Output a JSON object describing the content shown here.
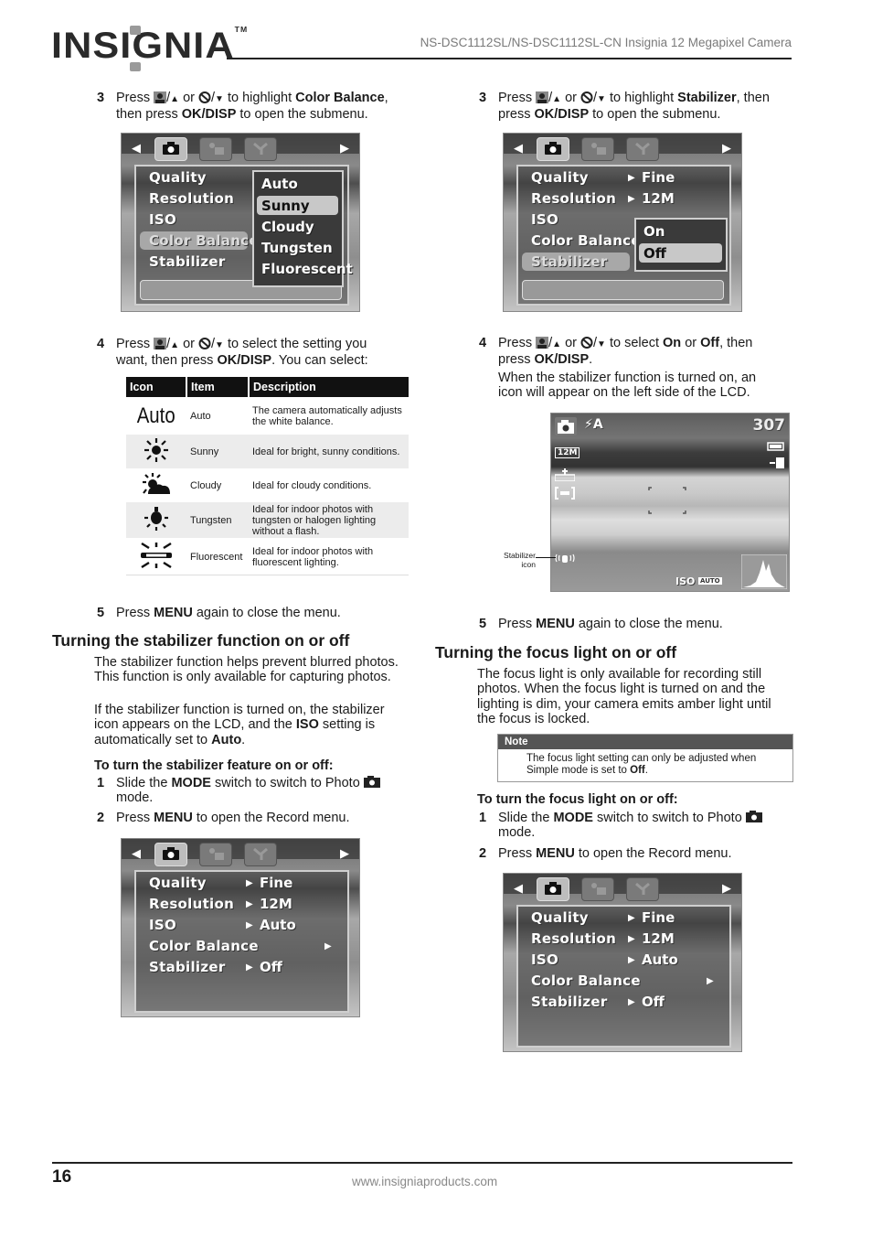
{
  "header": {
    "logo": "INSIGNIA",
    "logo_tm": "TM",
    "title": "NS-DSC1112SL/NS-DSC1112SL-CN Insignia 12 Megapixel Camera"
  },
  "left": {
    "step3": {
      "num": "3",
      "pre": "Press",
      "mid1": "/",
      "up": "▲",
      "or": "or",
      "mid2": "/",
      "down": "▼",
      "post": "to highlight",
      "bold1": "Color Balance",
      "comma": ",",
      "line2_pre": "then press",
      "bold2": "OK/DISP",
      "line2_post": "to open the submenu."
    },
    "screen1": {
      "menu_items": [
        "Quality",
        "Resolution",
        "ISO",
        "Color Balance",
        "Stabilizer"
      ],
      "highlighted": "Color Balance",
      "submenu": [
        "Auto",
        "Sunny",
        "Cloudy",
        "Tungsten",
        "Fluorescent"
      ],
      "submenu_selected": "Sunny"
    },
    "step4": {
      "num": "4",
      "pre": "Press",
      "mid1": "/",
      "up": "▲",
      "or": "or",
      "mid2": "/",
      "down": "▼",
      "post": "to select the setting you",
      "line2_pre": "want, then press",
      "bold": "OK/DISP",
      "line2_post": ". You can select:"
    },
    "table": {
      "headers": [
        "Icon",
        "Item",
        "Description"
      ],
      "rows": [
        {
          "icon": "Auto",
          "icon_name": "auto-text-icon",
          "item": "Auto",
          "desc": "The camera automatically adjusts the white balance."
        },
        {
          "icon": "",
          "icon_name": "sun-icon",
          "item": "Sunny",
          "desc": "Ideal for bright, sunny conditions."
        },
        {
          "icon": "",
          "icon_name": "cloud-sun-icon",
          "item": "Cloudy",
          "desc": "Ideal for cloudy conditions."
        },
        {
          "icon": "",
          "icon_name": "light-bulb-icon",
          "item": "Tungsten",
          "desc": "Ideal for indoor photos with tungsten or halogen lighting without a flash."
        },
        {
          "icon": "",
          "icon_name": "fluorescent-tube-icon",
          "item": "Fluorescent",
          "desc": "Ideal for indoor photos with fluorescent lighting."
        }
      ]
    },
    "step5": {
      "num": "5",
      "pre": "Press",
      "bold": "MENU",
      "post": "again to close the menu."
    },
    "section_title": "Turning the stabilizer function on or off",
    "para1": "The stabilizer function helps prevent blurred photos. This function is only available for capturing photos.",
    "para2_pre": "If the stabilizer function is turned on, the stabilizer icon appears on the LCD, and the",
    "para2_bold1": "ISO",
    "para2_mid": "setting is automatically set to",
    "para2_bold2": "Auto",
    "para2_end": ".",
    "sub_heading": "To turn the stabilizer feature on or off:",
    "s1": {
      "num": "1",
      "pre": "Slide the",
      "bold": "MODE",
      "post": "switch to switch to Photo",
      "line2": "mode."
    },
    "s2": {
      "num": "2",
      "pre": "Press",
      "bold": "MENU",
      "post": "to open the Record menu."
    },
    "screen2": {
      "menu_items": [
        {
          "label": "Quality",
          "value": "Fine"
        },
        {
          "label": "Resolution",
          "value": "12M"
        },
        {
          "label": "ISO",
          "value": "Auto"
        },
        {
          "label": "Color Balance",
          "value": ""
        },
        {
          "label": "Stabilizer",
          "value": "Off"
        }
      ]
    }
  },
  "right": {
    "step3": {
      "num": "3",
      "pre": "Press",
      "mid1": "/",
      "up": "▲",
      "or": "or",
      "mid2": "/",
      "down": "▼",
      "post": "to highlight",
      "bold1": "Stabilizer",
      "comma": ", then",
      "line2_pre": "press",
      "bold2": "OK/DISP",
      "line2_post": "to open the submenu."
    },
    "screen1": {
      "menu_items": [
        {
          "label": "Quality",
          "value": "Fine"
        },
        {
          "label": "Resolution",
          "value": "12M"
        },
        {
          "label": "ISO",
          "value": ""
        },
        {
          "label": "Color Balance",
          "value": ""
        },
        {
          "label": "Stabilizer",
          "value": ""
        }
      ],
      "highlighted": "Stabilizer",
      "submenu": [
        "On",
        "Off"
      ],
      "submenu_selected": "Off"
    },
    "step4": {
      "num": "4",
      "pre": "Press",
      "mid1": "/",
      "up": "▲",
      "or": "or",
      "mid2": "/",
      "down": "▼",
      "post": "to select",
      "bold1": "On",
      "or2": "or",
      "bold2": "Off",
      "post2": ", then",
      "line2_pre": "press",
      "bold3": "OK/DISP",
      "line2_post": "."
    },
    "step4_para": "When the stabilizer function is turned on, an icon will appear on the left side of the LCD.",
    "lcd": {
      "flash": "⚡A",
      "shots_remaining": "307",
      "resolution": "12M",
      "iso_label": "ISO",
      "iso_value": "AUTO",
      "callout": "Stabilizer icon"
    },
    "step5": {
      "num": "5",
      "pre": "Press",
      "bold": "MENU",
      "post": "again to close the menu."
    },
    "section_title": "Turning the focus light on or off",
    "para1": "The focus light is only available for recording still photos. When the focus light is turned on and the lighting is dim, your camera emits amber light until the focus is locked.",
    "note": {
      "title": "Note",
      "pre": "The focus light setting can only be adjusted when Simple mode is set to",
      "bold": "Off",
      "end": "."
    },
    "sub_heading": "To turn the focus light on or off:",
    "s1": {
      "num": "1",
      "pre": "Slide the",
      "bold": "MODE",
      "post": "switch to switch to Photo",
      "line2": "mode."
    },
    "s2": {
      "num": "2",
      "pre": "Press",
      "bold": "MENU",
      "post": "to open the Record menu."
    },
    "screen2": {
      "menu_items": [
        {
          "label": "Quality",
          "value": "Fine"
        },
        {
          "label": "Resolution",
          "value": "12M"
        },
        {
          "label": "ISO",
          "value": "Auto"
        },
        {
          "label": "Color Balance",
          "value": ""
        },
        {
          "label": "Stabilizer",
          "value": "Off"
        }
      ]
    }
  },
  "footer": {
    "page_number": "16",
    "url": "www.insigniaproducts.com"
  }
}
